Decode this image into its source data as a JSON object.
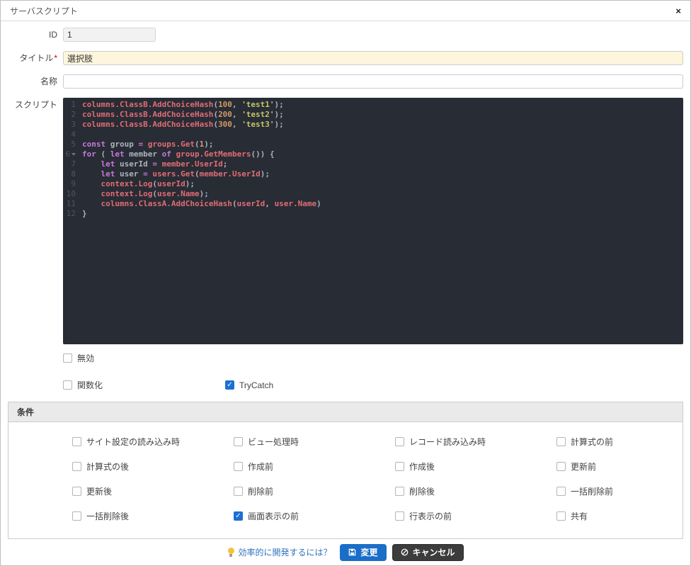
{
  "dialog": {
    "title": "サーバスクリプト",
    "close_label": "×"
  },
  "fields": {
    "id": {
      "label": "ID",
      "value": "1"
    },
    "title": {
      "label": "タイトル",
      "required_mark": "*",
      "value": "選択肢"
    },
    "name": {
      "label": "名称",
      "value": ""
    },
    "script": {
      "label": "スクリプト"
    }
  },
  "editor": {
    "colors": {
      "bg": "#282c34",
      "text": "#abb2bf",
      "gutter": "#4f5666",
      "keyword": "#c678dd",
      "member": "#e06c75",
      "number": "#d19a66",
      "string": "#c3c46d"
    },
    "lines": [
      {
        "n": "1",
        "tokens": [
          [
            "mem",
            "columns.ClassB.AddChoiceHash"
          ],
          [
            "pl",
            "("
          ],
          [
            "num",
            "100"
          ],
          [
            "pl",
            ", "
          ],
          [
            "str",
            "'test1'"
          ],
          [
            "pl",
            ");"
          ]
        ]
      },
      {
        "n": "2",
        "tokens": [
          [
            "mem",
            "columns.ClassB.AddChoiceHash"
          ],
          [
            "pl",
            "("
          ],
          [
            "num",
            "200"
          ],
          [
            "pl",
            ", "
          ],
          [
            "str",
            "'test2'"
          ],
          [
            "pl",
            ");"
          ]
        ]
      },
      {
        "n": "3",
        "tokens": [
          [
            "mem",
            "columns.ClassB.AddChoiceHash"
          ],
          [
            "pl",
            "("
          ],
          [
            "num",
            "300"
          ],
          [
            "pl",
            ", "
          ],
          [
            "str",
            "'test3'"
          ],
          [
            "pl",
            ");"
          ]
        ]
      },
      {
        "n": "4",
        "tokens": []
      },
      {
        "n": "5",
        "tokens": [
          [
            "kw",
            "const"
          ],
          [
            "pl",
            " group "
          ],
          [
            "op",
            "="
          ],
          [
            "pl",
            " "
          ],
          [
            "mem",
            "groups.Get"
          ],
          [
            "pl",
            "("
          ],
          [
            "num",
            "1"
          ],
          [
            "pl",
            ");"
          ]
        ]
      },
      {
        "n": "6",
        "fold": true,
        "tokens": [
          [
            "kw",
            "for"
          ],
          [
            "pl",
            " ( "
          ],
          [
            "kw",
            "let"
          ],
          [
            "pl",
            " member "
          ],
          [
            "kw",
            "of"
          ],
          [
            "pl",
            " "
          ],
          [
            "mem",
            "group.GetMembers"
          ],
          [
            "pl",
            "()) {"
          ]
        ]
      },
      {
        "n": "7",
        "tokens": [
          [
            "pl",
            "    "
          ],
          [
            "kw",
            "let"
          ],
          [
            "pl",
            " userId "
          ],
          [
            "op",
            "="
          ],
          [
            "pl",
            " "
          ],
          [
            "mem",
            "member.UserId"
          ],
          [
            "pl",
            ";"
          ]
        ]
      },
      {
        "n": "8",
        "tokens": [
          [
            "pl",
            "    "
          ],
          [
            "kw",
            "let"
          ],
          [
            "pl",
            " user "
          ],
          [
            "op",
            "="
          ],
          [
            "pl",
            " "
          ],
          [
            "mem",
            "users.Get"
          ],
          [
            "pl",
            "("
          ],
          [
            "mem",
            "member.UserId"
          ],
          [
            "pl",
            ");"
          ]
        ]
      },
      {
        "n": "9",
        "tokens": [
          [
            "pl",
            "    "
          ],
          [
            "mem",
            "context.Log"
          ],
          [
            "pl",
            "("
          ],
          [
            "mem",
            "userId"
          ],
          [
            "pl",
            ");"
          ]
        ]
      },
      {
        "n": "10",
        "tokens": [
          [
            "pl",
            "    "
          ],
          [
            "mem",
            "context.Log"
          ],
          [
            "pl",
            "("
          ],
          [
            "mem",
            "user.Name"
          ],
          [
            "pl",
            ");"
          ]
        ]
      },
      {
        "n": "11",
        "tokens": [
          [
            "pl",
            "    "
          ],
          [
            "mem",
            "columns.ClassA.AddChoiceHash"
          ],
          [
            "pl",
            "("
          ],
          [
            "mem",
            "userId"
          ],
          [
            "pl",
            ", "
          ],
          [
            "mem",
            "user.Name"
          ],
          [
            "pl",
            ")"
          ]
        ]
      },
      {
        "n": "12",
        "tokens": [
          [
            "pl",
            "}"
          ]
        ]
      }
    ]
  },
  "options": {
    "disabled": {
      "label": "無効",
      "checked": false
    },
    "functionalize": {
      "label": "関数化",
      "checked": false
    },
    "trycatch": {
      "label": "TryCatch",
      "checked": true
    }
  },
  "conditions": {
    "legend": "条件",
    "items": [
      {
        "label": "サイト設定の読み込み時",
        "checked": false
      },
      {
        "label": "ビュー処理時",
        "checked": false
      },
      {
        "label": "レコード読み込み時",
        "checked": false
      },
      {
        "label": "計算式の前",
        "checked": false
      },
      {
        "label": "計算式の後",
        "checked": false
      },
      {
        "label": "作成前",
        "checked": false
      },
      {
        "label": "作成後",
        "checked": false
      },
      {
        "label": "更新前",
        "checked": false
      },
      {
        "label": "更新後",
        "checked": false
      },
      {
        "label": "削除前",
        "checked": false
      },
      {
        "label": "削除後",
        "checked": false
      },
      {
        "label": "一括削除前",
        "checked": false
      },
      {
        "label": "一括削除後",
        "checked": false
      },
      {
        "label": "画面表示の前",
        "checked": true
      },
      {
        "label": "行表示の前",
        "checked": false
      },
      {
        "label": "共有",
        "checked": false
      }
    ]
  },
  "footer": {
    "hint_icon": "lightbulb",
    "hint_link": "効率的に開発するには？",
    "change_label": "変更",
    "cancel_label": "キャンセル"
  },
  "colors": {
    "accent_blue": "#1b6ec7",
    "checkbox_checked": "#1d6fd3",
    "title_field_bg": "#fdf5dc",
    "link_blue": "#3072be"
  }
}
